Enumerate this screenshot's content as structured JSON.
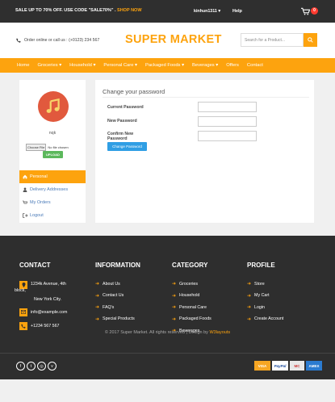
{
  "topbar": {
    "promo_text": "SALE UP TO 70% OFF. USE CODE \"SALE70%\" . ",
    "promo_link": "SHOP NOW",
    "user": "kinhun1311 ▾",
    "help": "Help",
    "cart_count": "0"
  },
  "header": {
    "contact": "Order online or call us : (+0123) 234 567",
    "logo": "SUPER MARKET",
    "search_placeholder": "Search for a Product..."
  },
  "nav": {
    "items": [
      "Home",
      "Groceries ▾",
      "Household ▾",
      "Personal Care ▾",
      "Packaged Foods ▾",
      "Beverages ▾",
      "Offers",
      "Contact"
    ]
  },
  "sidebar": {
    "username": "nqk",
    "choose_file": "Choose File",
    "no_file": "No file chosen",
    "upload": "UPLOAD",
    "menu": [
      "Personal",
      "Delivery Addresses",
      "My Orders",
      "Logout"
    ]
  },
  "panel": {
    "title": "Change your password",
    "current": "Current Password",
    "new": "New Password",
    "confirm_1": "Confirm New",
    "confirm_2": "Password",
    "button": "Change Password"
  },
  "footer": {
    "contact_heading": "CONTACT",
    "address_1": "1234k Avenue, 4th",
    "address_2": "block,",
    "address_3": "New York City.",
    "email": "info@example.com",
    "phone": "+1234 567 567",
    "info_heading": "INFORMATION",
    "info": [
      "About Us",
      "Contact Us",
      "FAQ's",
      "Special Products"
    ],
    "category_heading": "CATEGORY",
    "category": [
      "Groceries",
      "Household",
      "Personal Care",
      "Packaged Foods",
      "Beverages"
    ],
    "profile_heading": "PROFILE",
    "profile": [
      "Store",
      "My Cart",
      "Login",
      "Create Account"
    ],
    "copyright": "© 2017 Super Market. All rights reserved | Design by ",
    "designer": "W3layouts"
  },
  "bottom": {
    "social": [
      "f",
      "t",
      "◎",
      "v"
    ],
    "payments": [
      "VISA",
      "PayPal",
      "MC",
      "AMEX"
    ]
  },
  "colors": {
    "accent": "#fda30e",
    "dark": "#2e2e2e",
    "button_blue": "#2f9ee4",
    "upload_green": "#5cb85c"
  }
}
